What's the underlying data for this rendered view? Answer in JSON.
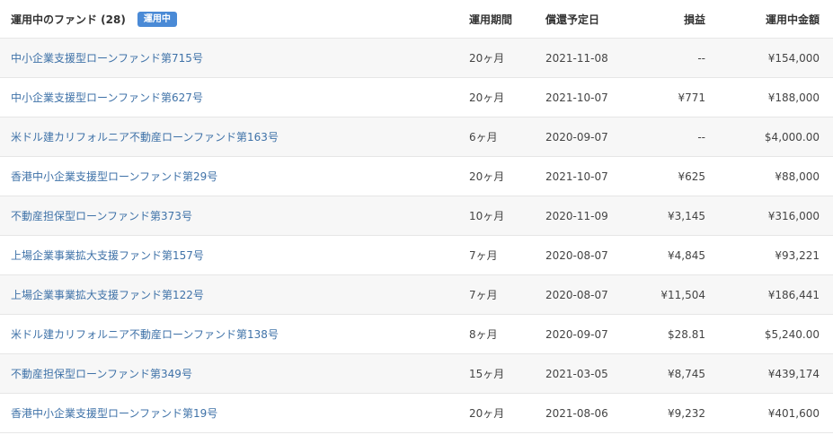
{
  "header": {
    "title": "運用中のファンド (28)",
    "badge": "運用中",
    "col_term": "運用期間",
    "col_date": "償還予定日",
    "col_profit": "損益",
    "col_amount": "運用中金額"
  },
  "funds": [
    {
      "name": "中小企業支援型ローンファンド第715号",
      "term": "20ヶ月",
      "date": "2021-11-08",
      "profit": "--",
      "amount": "¥154,000"
    },
    {
      "name": "中小企業支援型ローンファンド第627号",
      "term": "20ヶ月",
      "date": "2021-10-07",
      "profit": "¥771",
      "amount": "¥188,000"
    },
    {
      "name": "米ドル建カリフォルニア不動産ローンファンド第163号",
      "term": "6ヶ月",
      "date": "2020-09-07",
      "profit": "--",
      "amount": "$4,000.00"
    },
    {
      "name": "香港中小企業支援型ローンファンド第29号",
      "term": "20ヶ月",
      "date": "2021-10-07",
      "profit": "¥625",
      "amount": "¥88,000"
    },
    {
      "name": "不動産担保型ローンファンド第373号",
      "term": "10ヶ月",
      "date": "2020-11-09",
      "profit": "¥3,145",
      "amount": "¥316,000"
    },
    {
      "name": "上場企業事業拡大支援ファンド第157号",
      "term": "7ヶ月",
      "date": "2020-08-07",
      "profit": "¥4,845",
      "amount": "¥93,221"
    },
    {
      "name": "上場企業事業拡大支援ファンド第122号",
      "term": "7ヶ月",
      "date": "2020-08-07",
      "profit": "¥11,504",
      "amount": "¥186,441"
    },
    {
      "name": "米ドル建カリフォルニア不動産ローンファンド第138号",
      "term": "8ヶ月",
      "date": "2020-09-07",
      "profit": "$28.81",
      "amount": "$5,240.00"
    },
    {
      "name": "不動産担保型ローンファンド第349号",
      "term": "15ヶ月",
      "date": "2021-03-05",
      "profit": "¥8,745",
      "amount": "¥439,174"
    },
    {
      "name": "香港中小企業支援型ローンファンド第19号",
      "term": "20ヶ月",
      "date": "2021-08-06",
      "profit": "¥9,232",
      "amount": "¥401,600"
    }
  ]
}
